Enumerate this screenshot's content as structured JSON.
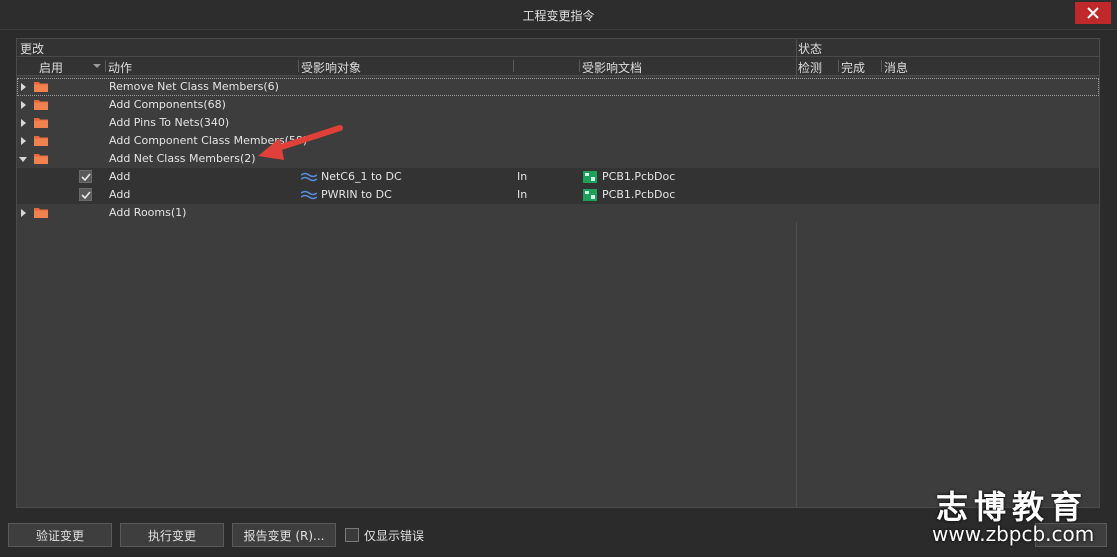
{
  "window": {
    "title": "工程变更指令"
  },
  "header": {
    "group_change": "更改",
    "group_status": "状态",
    "col_enable": "启用",
    "col_action": "动作",
    "col_object": "受影响对象",
    "col_document": "受影响文档",
    "col_check": "检测",
    "col_done": "完成",
    "col_message": "消息"
  },
  "rows": [
    {
      "type": "group",
      "expanded": false,
      "label": "Remove Net Class Members(6)"
    },
    {
      "type": "group",
      "expanded": false,
      "label": "Add Components(68)"
    },
    {
      "type": "group",
      "expanded": false,
      "label": "Add Pins To Nets(340)"
    },
    {
      "type": "group",
      "expanded": false,
      "label": "Add Component Class Members(58)"
    },
    {
      "type": "group",
      "expanded": true,
      "label": "Add Net Class Members(2)"
    },
    {
      "type": "child",
      "checked": true,
      "action": "Add",
      "object": "NetC6_1 to DC",
      "direction": "In",
      "document": "PCB1.PcbDoc"
    },
    {
      "type": "child",
      "checked": true,
      "action": "Add",
      "object": "PWRIN to DC",
      "direction": "In",
      "document": "PCB1.PcbDoc"
    },
    {
      "type": "group",
      "expanded": false,
      "label": "Add Rooms(1)"
    }
  ],
  "buttons": {
    "validate": "验证变更",
    "execute": "执行变更",
    "report": "报告变更 (R)...",
    "only_errors": "仅显示错误"
  },
  "watermark": {
    "brand": "志博教育",
    "url": "www.zbpcb.com"
  },
  "colors": {
    "close_bg": "#c0282a",
    "folder": "#e8673a",
    "annotation_arrow": "#e0403a",
    "net_icon": "#5a8ee0",
    "doc_icon": "#1fa05a"
  }
}
